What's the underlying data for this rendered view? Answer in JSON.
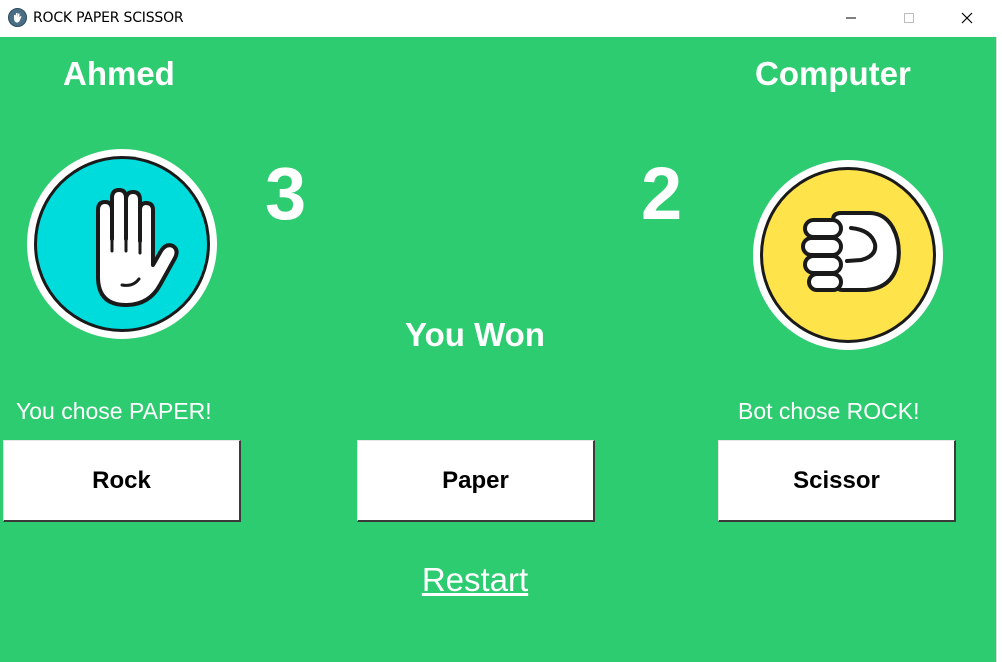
{
  "window": {
    "title": "ROCK PAPER SCISSOR",
    "app_icon": "rock-hand-icon",
    "controls": {
      "minimize_glyph": "—",
      "maximize_glyph": "☐",
      "close_glyph": "✕"
    }
  },
  "colors": {
    "background": "#2ecc71",
    "player_hand_bg": "#00dcdc",
    "bot_hand_bg": "#ffe34a",
    "text": "#ffffff"
  },
  "player": {
    "name": "Ahmed",
    "score": "3",
    "hand_icon": "paper-hand-icon",
    "choice_text": "You chose PAPER!"
  },
  "bot": {
    "name": "Computer",
    "score": "2",
    "hand_icon": "rock-fist-icon",
    "choice_text": "Bot chose ROCK!"
  },
  "result": "You Won",
  "buttons": {
    "rock": "Rock",
    "paper": "Paper",
    "scissor": "Scissor"
  },
  "restart_label": "Restart"
}
